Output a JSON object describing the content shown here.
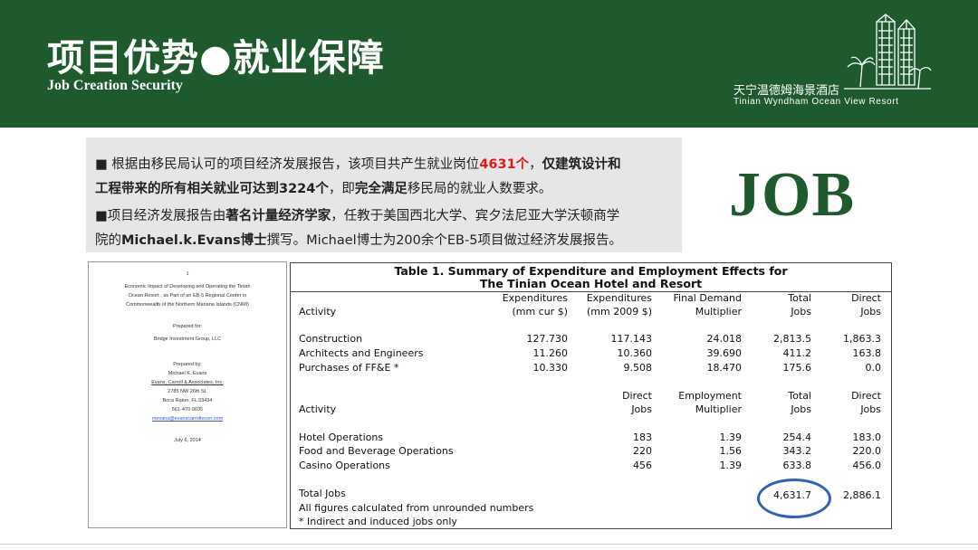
{
  "header": {
    "title": "项目优势●就业保障",
    "subtitle": "Job Creation Security",
    "logo_cn": "天宁温德姆海景酒店",
    "logo_en": "Tinian Wyndham Ocean View Resort"
  },
  "intro": {
    "p1_a": "■ 根据由移民局认可的项目经济发展报告，该项目共产生就业岗位",
    "p1_num": "4631个",
    "p1_sep": "，",
    "p1_bold": "仅建筑设计和",
    "p1_line2_bold": "工程带来的所有相关就业可达到3224个",
    "p1_line2_mid": "，即",
    "p1_line2_bold2": "完全满足",
    "p1_line2_end": "移民局的就业人数要求。",
    "p2_a": "■项目经济发展报告由",
    "p2_bold": "著名计量经济学家",
    "p2_b": "，任教于美国西北大学、宾夕法尼亚大学沃顿商学",
    "p2_line2_a": "院的",
    "p2_line2_bold": "Michael.k.Evans博士",
    "p2_line2_b": "撰写。Michael博士为200余个EB-5项目做过经济发展报告。"
  },
  "job_word": "JOB",
  "cover": {
    "mark": "1",
    "t1": "Economic Impact of Developing and Operating the Tinian",
    "t2": "Ocean Resort , as Part of an EB-5 Regional Center in",
    "t3": "Commonwealth of the Northern Mariana Islands (CNMI)",
    "prepared_for": "Prepared for:",
    "client": "Bridge Investment Group, LLC",
    "prepared_by": "Prepared by:",
    "author": "Michael K. Evans",
    "firm": "Evans, Carroll & Associates, Inc.",
    "addr1": "2785 NW 26th St.",
    "addr2": "Boca Raton, FL 33434",
    "phone": "561-470-9035",
    "email": "mevans@evanscarrollecon.com",
    "date": "July 6, 2014"
  },
  "table": {
    "title1": "Table 1.  Summary of Expenditure and Employment Effects for",
    "title2": "The Tinian Ocean Hotel and Resort",
    "h1": {
      "activity": "Activity",
      "c1a": "Expenditures",
      "c1b": "(mm cur $)",
      "c2a": "Expenditures",
      "c2b": "(mm 2009 $)",
      "c3a": "Final Demand",
      "c3b": "Multiplier",
      "c4a": "Total",
      "c4b": "Jobs",
      "c5a": "Direct",
      "c5b": "Jobs"
    },
    "rows1": [
      {
        "name": "Construction",
        "v1": "127.730",
        "v2": "117.143",
        "v3": "24.018",
        "v4": "2,813.5",
        "v5": "1,863.3"
      },
      {
        "name": "Architects and Engineers",
        "v1": "11.260",
        "v2": "10.360",
        "v3": "39.690",
        "v4": "411.2",
        "v5": "163.8"
      },
      {
        "name": "Purchases of FF&E *",
        "v1": "10.330",
        "v2": "9.508",
        "v3": "18.470",
        "v4": "175.6",
        "v5": "0.0"
      }
    ],
    "h2": {
      "activity": "Activity",
      "c1a": "Direct",
      "c1b": "Jobs",
      "c2a": "Employment",
      "c2b": "Multiplier",
      "c3a": "Total",
      "c3b": "Jobs",
      "c4a": "Direct",
      "c4b": "Jobs"
    },
    "rows2": [
      {
        "name": "Hotel Operations",
        "v1": "183",
        "v2": "1.39",
        "v3": "254.4",
        "v4": "183.0"
      },
      {
        "name": "Food and Beverage Operations",
        "v1": "220",
        "v2": "1.56",
        "v3": "343.2",
        "v4": "220.0"
      },
      {
        "name": "Casino Operations",
        "v1": "456",
        "v2": "1.39",
        "v3": "633.8",
        "v4": "456.0"
      }
    ],
    "total_label": "Total Jobs",
    "total_value": "4,631.7",
    "total_direct": "2,886.1",
    "note1": "All figures calculated from unrounded numbers",
    "note2": "* Indirect and induced jobs only"
  },
  "colors": {
    "header_green": "#1e5a2e",
    "highlight_red": "#e01a1a",
    "circle_blue": "#2e63b5",
    "intro_bg": "#e6e6e6"
  }
}
